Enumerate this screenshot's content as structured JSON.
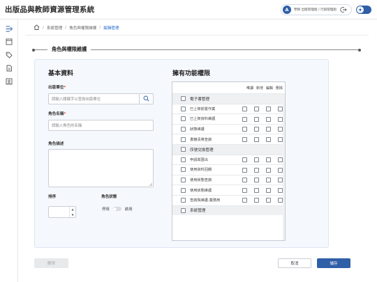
{
  "app": {
    "title": "出版品與教師資源管理系統",
    "user_initial": "A",
    "user_label": "學務 出版管理組 / 行銷管理組"
  },
  "breadcrumb": [
    "系統管理",
    "角色與權限維護",
    "編輯管理"
  ],
  "section_title": "角色與權限維護",
  "basic_info": {
    "title": "基本資料",
    "unit_label": "出版單位",
    "unit_placeholder": "請輸入關鍵字以查詢出版單位",
    "role_name_label": "角色名稱",
    "role_name_placeholder": "請輸入角色的名稱",
    "role_desc_label": "角色描述",
    "role_desc_value": "",
    "sort_label": "排序",
    "sort_value": "",
    "status_label": "角色狀態",
    "status_off": "停用",
    "status_on": "啟用",
    "status_enabled": false,
    "required_mark": "*"
  },
  "permissions": {
    "title": "擁有功能權限",
    "columns": [
      "唯讀",
      "新增",
      "編輯",
      "刪除"
    ],
    "rows": [
      {
        "label": "電子書管理",
        "group": true
      },
      {
        "label": "已上架前置作業",
        "group": false
      },
      {
        "label": "已上架資料維護",
        "group": false
      },
      {
        "label": "狀態維護",
        "group": false
      },
      {
        "label": "書籍清單查詢",
        "group": false
      },
      {
        "label": "序號兌換管理",
        "group": true
      },
      {
        "label": "申請與匯出",
        "group": false
      },
      {
        "label": "使用資料回饋",
        "group": false
      },
      {
        "label": "使用狀態查詢",
        "group": false
      },
      {
        "label": "使用狀態維護",
        "group": false
      },
      {
        "label": "查詢與維護-業務用",
        "group": false
      },
      {
        "label": "系統管理",
        "group": true
      }
    ]
  },
  "footer": {
    "delete_label": "刪除",
    "cancel_label": "取消",
    "save_label": "儲存"
  },
  "colors": {
    "primary": "#2f5fa7",
    "link": "#2f6fd0",
    "required": "#d93a3a"
  }
}
